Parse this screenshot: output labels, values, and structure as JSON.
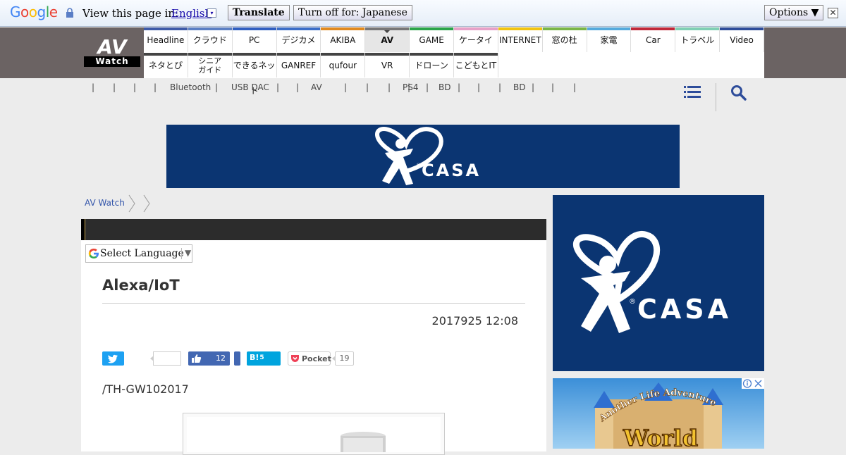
{
  "translate_bar": {
    "view_label": "View this page in:",
    "language": "English",
    "language_arrow": "▾",
    "translate_button": "Translate",
    "turnoff_button": "Turn off for: Japanese",
    "options_button": "Options ▼",
    "close_label": "✕"
  },
  "logo": {
    "top": "AV",
    "bottom": "Watch"
  },
  "nav": {
    "row1": [
      {
        "label": "Headline",
        "color": "#3d5aa8"
      },
      {
        "label": "クラウド",
        "color": "#5a7fc4"
      },
      {
        "label": "PC",
        "color": "#2f5fc1"
      },
      {
        "label": "デジカメ",
        "color": "#3a6ec8"
      },
      {
        "label": "AKIBA",
        "color": "#e08a1e"
      },
      {
        "label": "AV",
        "color": "#777777"
      },
      {
        "label": "GAME",
        "color": "#2aa44a"
      },
      {
        "label": "ケータイ",
        "color": "#e7a0c8"
      },
      {
        "label": "INTERNET",
        "color": "#f1c40f"
      },
      {
        "label": "窓の杜",
        "color": "#7ab648"
      },
      {
        "label": "家電",
        "color": "#55aadd"
      },
      {
        "label": "Car",
        "color": "#c0283a"
      },
      {
        "label": "トラベル",
        "color": "#7fcfb4"
      },
      {
        "label": "Video",
        "color": "#2d4c9a"
      }
    ],
    "row2": [
      {
        "label": "ネタとぴ",
        "color": "#444444"
      },
      {
        "label": "シニア\nガイド",
        "color": "#444444"
      },
      {
        "label": "できるネット",
        "color": "#444444"
      },
      {
        "label": "GANREF",
        "color": "#444444"
      },
      {
        "label": "qufour",
        "color": "#444444"
      },
      {
        "label": "VR",
        "color": "#444444"
      },
      {
        "label": "ドローン",
        "color": "#444444"
      },
      {
        "label": "こどもとIT",
        "color": "#444444"
      }
    ]
  },
  "subnav": {
    "items": [
      "|",
      "|",
      "|",
      "|",
      "Bluetooth",
      "|",
      "USB DAC",
      "|",
      "|",
      "AV",
      "|",
      "|",
      "|",
      "|",
      "PS4",
      "|",
      "BD",
      "|",
      "|",
      "|",
      "BD",
      "|",
      "|",
      "|"
    ]
  },
  "banner": {
    "brand": "CASA",
    "registered": "®"
  },
  "breadcrumb": {
    "home": "AV Watch"
  },
  "select_language": {
    "label": "Select Language",
    "arrow": "▼"
  },
  "article": {
    "title": "Alexa/IoT",
    "date": "2017925 12:08",
    "model": "/TH-GW102017"
  },
  "share": {
    "facebook_count": "12",
    "hatena_label": "B!",
    "hatena_count": "5",
    "pocket_label": "Pocket",
    "pocket_count": "19"
  },
  "ads": {
    "side_brand": "CASA",
    "side_registered": "®",
    "game_tagline": "Another Life Adventure",
    "game_title": "World"
  },
  "colors": {
    "casa_blue": "#0b3572",
    "header_gray": "#6b6363",
    "twitter": "#1da1f2",
    "facebook": "#4267b2",
    "hatena": "#00a4de"
  }
}
